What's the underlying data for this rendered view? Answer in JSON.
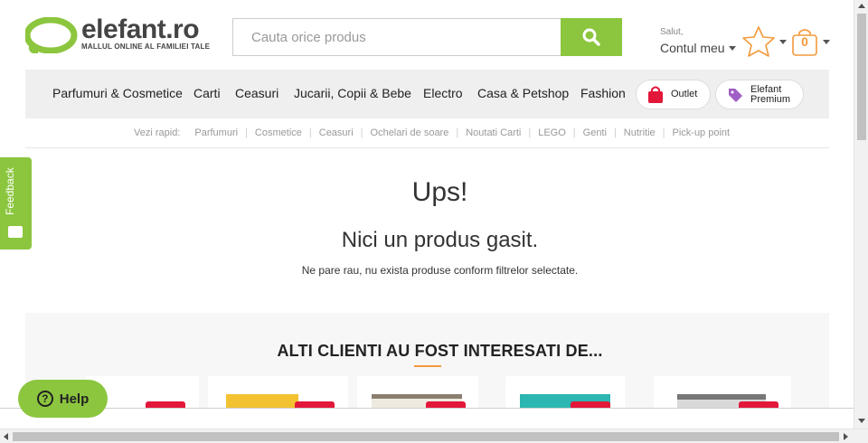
{
  "header": {
    "logo_text": "elefant.ro",
    "logo_tagline": "MALLUL ONLINE AL FAMILIEI TALE",
    "search_placeholder": "Cauta orice produs",
    "account_greeting": "Salut,",
    "account_label": "Contul meu",
    "cart_count": "0"
  },
  "nav": {
    "items": [
      "Parfumuri & Cosmetice",
      "Carti",
      "Ceasuri",
      "Jucarii, Copii & Bebe",
      "Electro",
      "Casa & Petshop",
      "Fashion"
    ],
    "outlet_label": "Outlet",
    "premium_label_line1": "Elefant",
    "premium_label_line2": "Premium"
  },
  "quick_links": {
    "label": "Vezi rapid:",
    "links": [
      "Parfumuri",
      "Cosmetice",
      "Ceasuri",
      "Ochelari de soare",
      "Noutati Carti",
      "LEGO",
      "Genti",
      "Nutritie",
      "Pick-up point"
    ]
  },
  "message": {
    "title": "Ups!",
    "subtitle": "Nici un produs gasit.",
    "text": "Ne pare rau, nu exista produse conform filtrelor selectate."
  },
  "recommendations": {
    "title": "ALTI CLIENTI AU FOST INTERESATI DE..."
  },
  "feedback_label": "Feedback",
  "help_label": "Help",
  "colors": {
    "brand_green": "#8cc63f",
    "accent_orange": "#f39a3b",
    "badge_red": "#e2173a",
    "outlet_red": "#e2173a",
    "premium_purple": "#a05fc4"
  },
  "icons": [
    "elephant-logo-icon",
    "search-icon",
    "star-icon",
    "cart-icon",
    "outlet-bag-icon",
    "premium-tag-icon",
    "feedback-icon",
    "help-question-icon"
  ]
}
